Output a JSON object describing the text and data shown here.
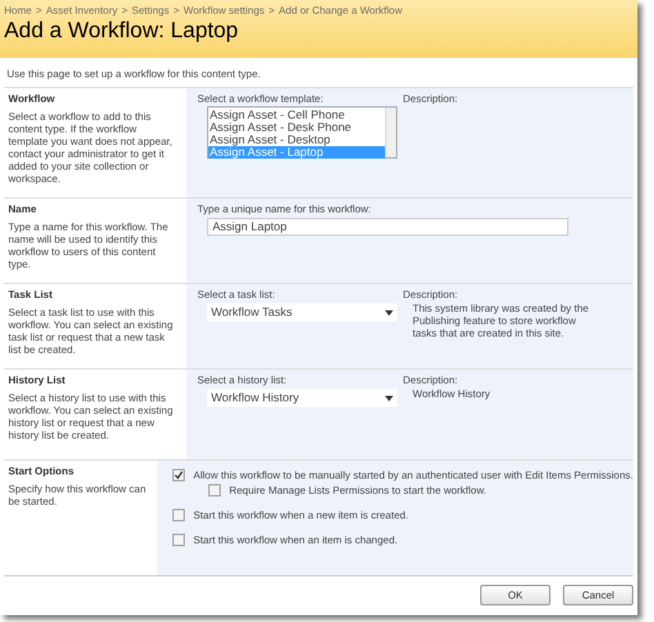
{
  "breadcrumb": {
    "separator": ">",
    "items": [
      "Home",
      "Asset Inventory",
      "Settings",
      "Workflow settings",
      "Add or Change a Workflow"
    ]
  },
  "title": "Add a Workflow: Laptop",
  "intro": "Use this page to set up a workflow for this content type.",
  "sections": [
    {
      "kind": "listbox",
      "title": "Workflow",
      "description": "Select a workflow to add to this content type. If the workflow template you want does not appear, contact your administrator to get it added to your site collection or workspace.",
      "label": "Select a workflow template:",
      "options": [
        {
          "text": "Assign Asset - Cell Phone",
          "selected": false
        },
        {
          "text": "Assign Asset - Desk Phone",
          "selected": false
        },
        {
          "text": "Assign Asset - Desktop",
          "selected": false
        },
        {
          "text": "Assign Asset - Laptop",
          "selected": true
        }
      ],
      "description_label": "Description:"
    },
    {
      "kind": "text",
      "title": "Name",
      "description": "Type a name for this workflow. The name will be used to identify this workflow to users of this content type.",
      "label": "Type a unique name for this workflow:",
      "value": "Assign Laptop"
    },
    {
      "kind": "select",
      "title": "Task List",
      "description": "Select a task list to use with this workflow. You can select an existing task list or request that a new task list be created.",
      "label": "Select a task list:",
      "value": "Workflow Tasks",
      "description_label": "Description:",
      "description_text": "This system library was created by the Publishing feature to store workflow tasks that are created in this site."
    },
    {
      "kind": "select",
      "title": "History List",
      "description": "Select a history list to use with this workflow. You can select an existing history list or request that a new history list be created.",
      "label": "Select a history list:",
      "value": "Workflow History",
      "description_label": "Description:",
      "description_text": "Workflow History"
    },
    {
      "kind": "checkboxes",
      "title": "Start Options",
      "description": "Specify how this workflow can be started.",
      "options": [
        {
          "text": "Allow this workflow to be manually started by an authenticated user with Edit Items Permissions.",
          "checked": true,
          "children": [
            {
              "text": "Require Manage Lists Permissions to start the workflow.",
              "checked": false
            }
          ]
        },
        {
          "text": "Start this workflow when a new item is created.",
          "checked": false
        },
        {
          "text": "Start this workflow when an item is changed.",
          "checked": false
        }
      ]
    }
  ],
  "buttons": [
    "OK",
    "Cancel"
  ]
}
